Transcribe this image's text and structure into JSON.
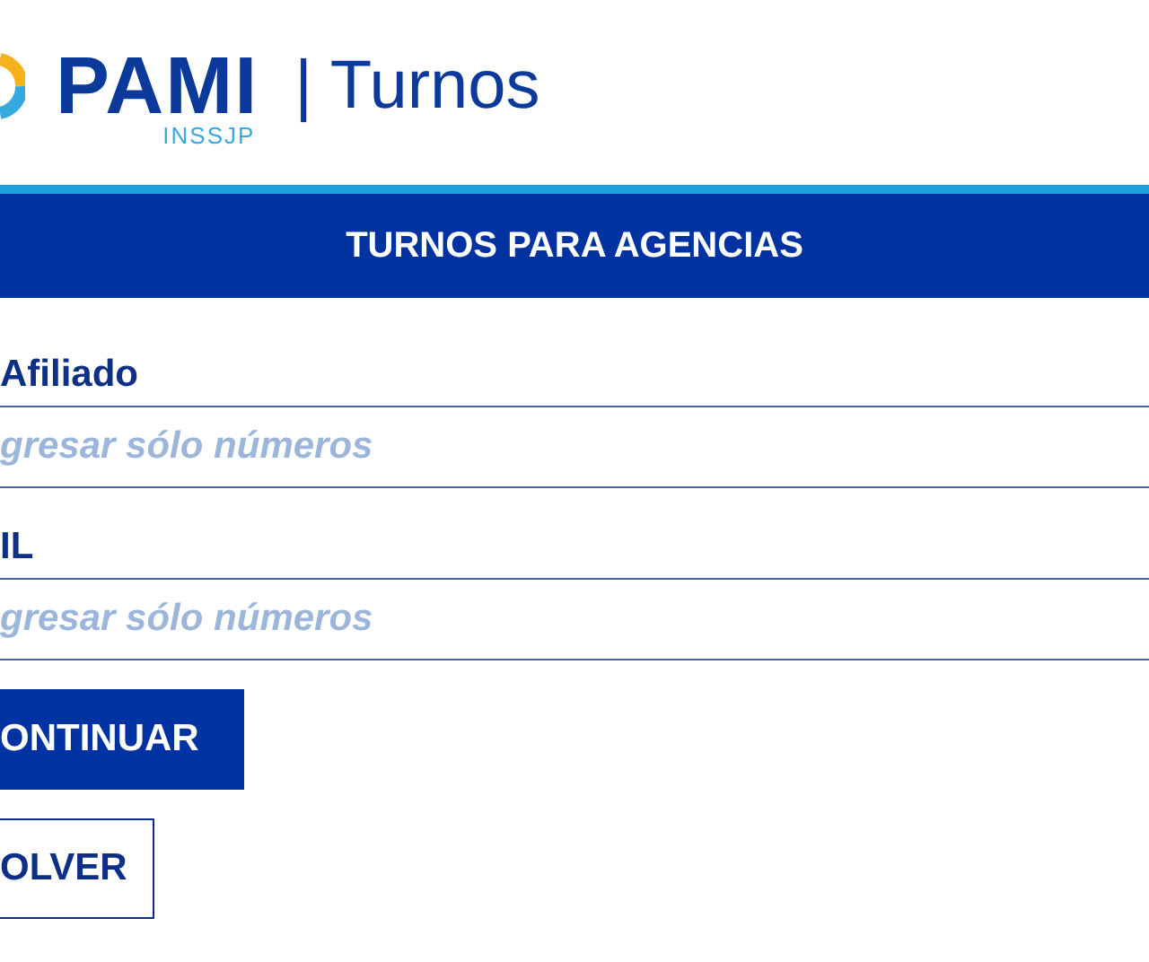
{
  "header": {
    "logo": "PAMI",
    "logo_subtitle": "INSSJP",
    "app_title": "| Turnos"
  },
  "form": {
    "title": "TURNOS PARA AGENCIAS",
    "fields": [
      {
        "label": "Afiliado",
        "placeholder": "gresar sólo números"
      },
      {
        "label": "IL",
        "placeholder": "gresar sólo números"
      }
    ],
    "buttons": [
      {
        "label": "ONTINUAR",
        "kind": "primary"
      },
      {
        "label": "OLVER",
        "kind": "secondary"
      }
    ]
  }
}
